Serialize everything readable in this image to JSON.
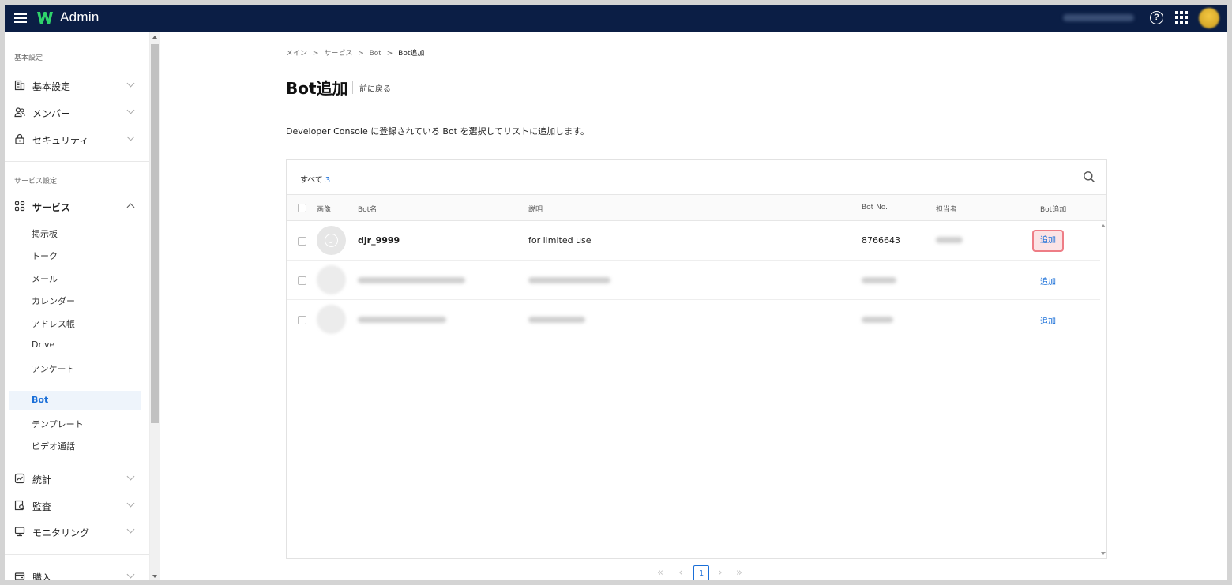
{
  "header": {
    "app_title": "Admin",
    "help_glyph": "?"
  },
  "sidebar": {
    "section_basic": "基本設定",
    "basic_items": [
      {
        "label": "基本設定",
        "icon": "building-icon"
      },
      {
        "label": "メンバー",
        "icon": "members-icon"
      },
      {
        "label": "セキュリティ",
        "icon": "lock-icon"
      }
    ],
    "section_service": "サービス設定",
    "service_label": "サービス",
    "service_subitems": [
      "掲示板",
      "トーク",
      "メール",
      "カレンダー",
      "アドレス帳",
      "Drive",
      "アンケート"
    ],
    "service_subitems2": [
      "Bot",
      "テンプレート",
      "ビデオ通話"
    ],
    "active_subitem": "Bot",
    "other_items": [
      {
        "label": "統計",
        "icon": "chart-icon"
      },
      {
        "label": "監査",
        "icon": "audit-icon"
      },
      {
        "label": "モニタリング",
        "icon": "monitor-icon"
      }
    ],
    "purchase_label": "購入"
  },
  "breadcrumb": [
    "メイン",
    "サービス",
    "Bot",
    "Bot追加"
  ],
  "breadcrumb_sep": ">",
  "page": {
    "title": "Bot追加",
    "back_label": "前に戻る",
    "description": "Developer Console に登録されている Bot を選択してリストに追加します。"
  },
  "table": {
    "count_label": "すべて",
    "count": "3",
    "columns": {
      "image": "画像",
      "name": "Bot名",
      "description": "説明",
      "bot_no": "Bot No.",
      "owner": "担当者",
      "add": "Bot追加"
    },
    "rows": [
      {
        "name": "djr_9999",
        "description": "for limited use",
        "bot_no": "8766643",
        "add_label": "追加",
        "highlighted": true
      },
      {
        "name": "",
        "description": "",
        "bot_no": "",
        "add_label": "追加",
        "highlighted": false
      },
      {
        "name": "",
        "description": "",
        "bot_no": "",
        "add_label": "追加",
        "highlighted": false
      }
    ]
  },
  "pagination": {
    "first": "«",
    "prev": "‹",
    "current": "1",
    "next": "›",
    "last": "»"
  },
  "colors": {
    "header_bg": "#0b1e45",
    "accent": "#1a6fd8",
    "highlight_border": "#ee7d86"
  }
}
